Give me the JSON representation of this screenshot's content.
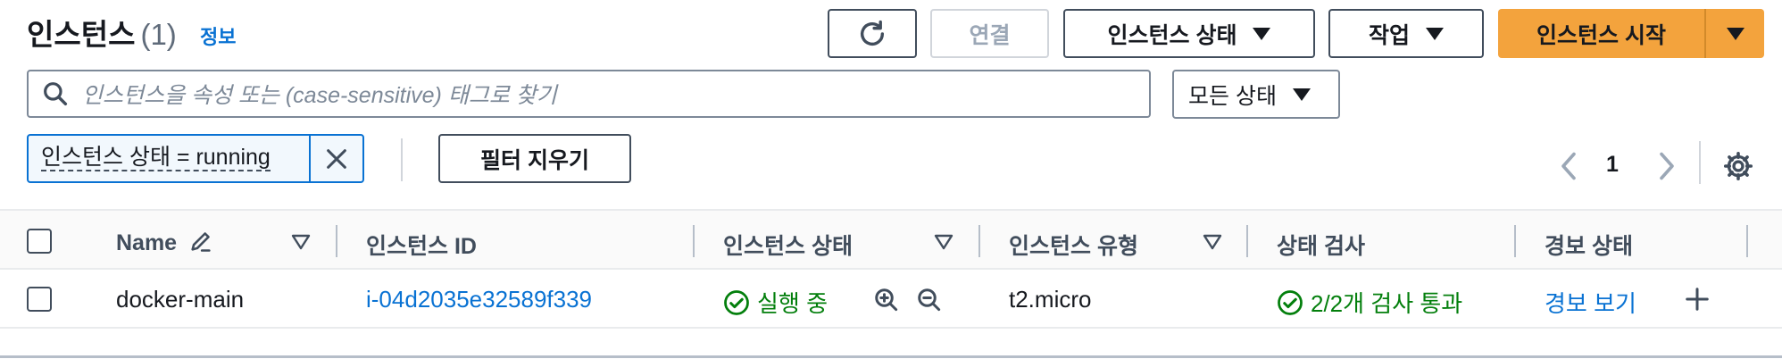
{
  "header": {
    "title": "인스턴스",
    "count": "(1)",
    "info_link": "정보"
  },
  "toolbar": {
    "refresh_icon": "refresh-icon",
    "connect_label": "연결",
    "instance_state_label": "인스턴스 상태",
    "actions_label": "작업",
    "launch_label": "인스턴스 시작"
  },
  "search": {
    "placeholder": "인스턴스을 속성 또는 (case-sensitive) 태그로 찾기",
    "state_filter": "모든 상태"
  },
  "filters": {
    "token_label": "인스턴스 상태 = running",
    "clear_label": "필터 지우기"
  },
  "pagination": {
    "current_page": "1"
  },
  "table": {
    "columns": [
      "Name",
      "인스턴스 ID",
      "인스턴스 상태",
      "인스턴스 유형",
      "상태 검사",
      "경보 상태"
    ],
    "rows": [
      {
        "name": "docker-main",
        "instance_id": "i-04d2035e32589f339",
        "state": "실행 중",
        "type": "t2.micro",
        "status_check": "2/2개 검사 통과",
        "alarm": "경보 보기"
      }
    ]
  },
  "colors": {
    "primary": "#f3a33d",
    "link": "#0972d3",
    "success": "#037f0c"
  }
}
